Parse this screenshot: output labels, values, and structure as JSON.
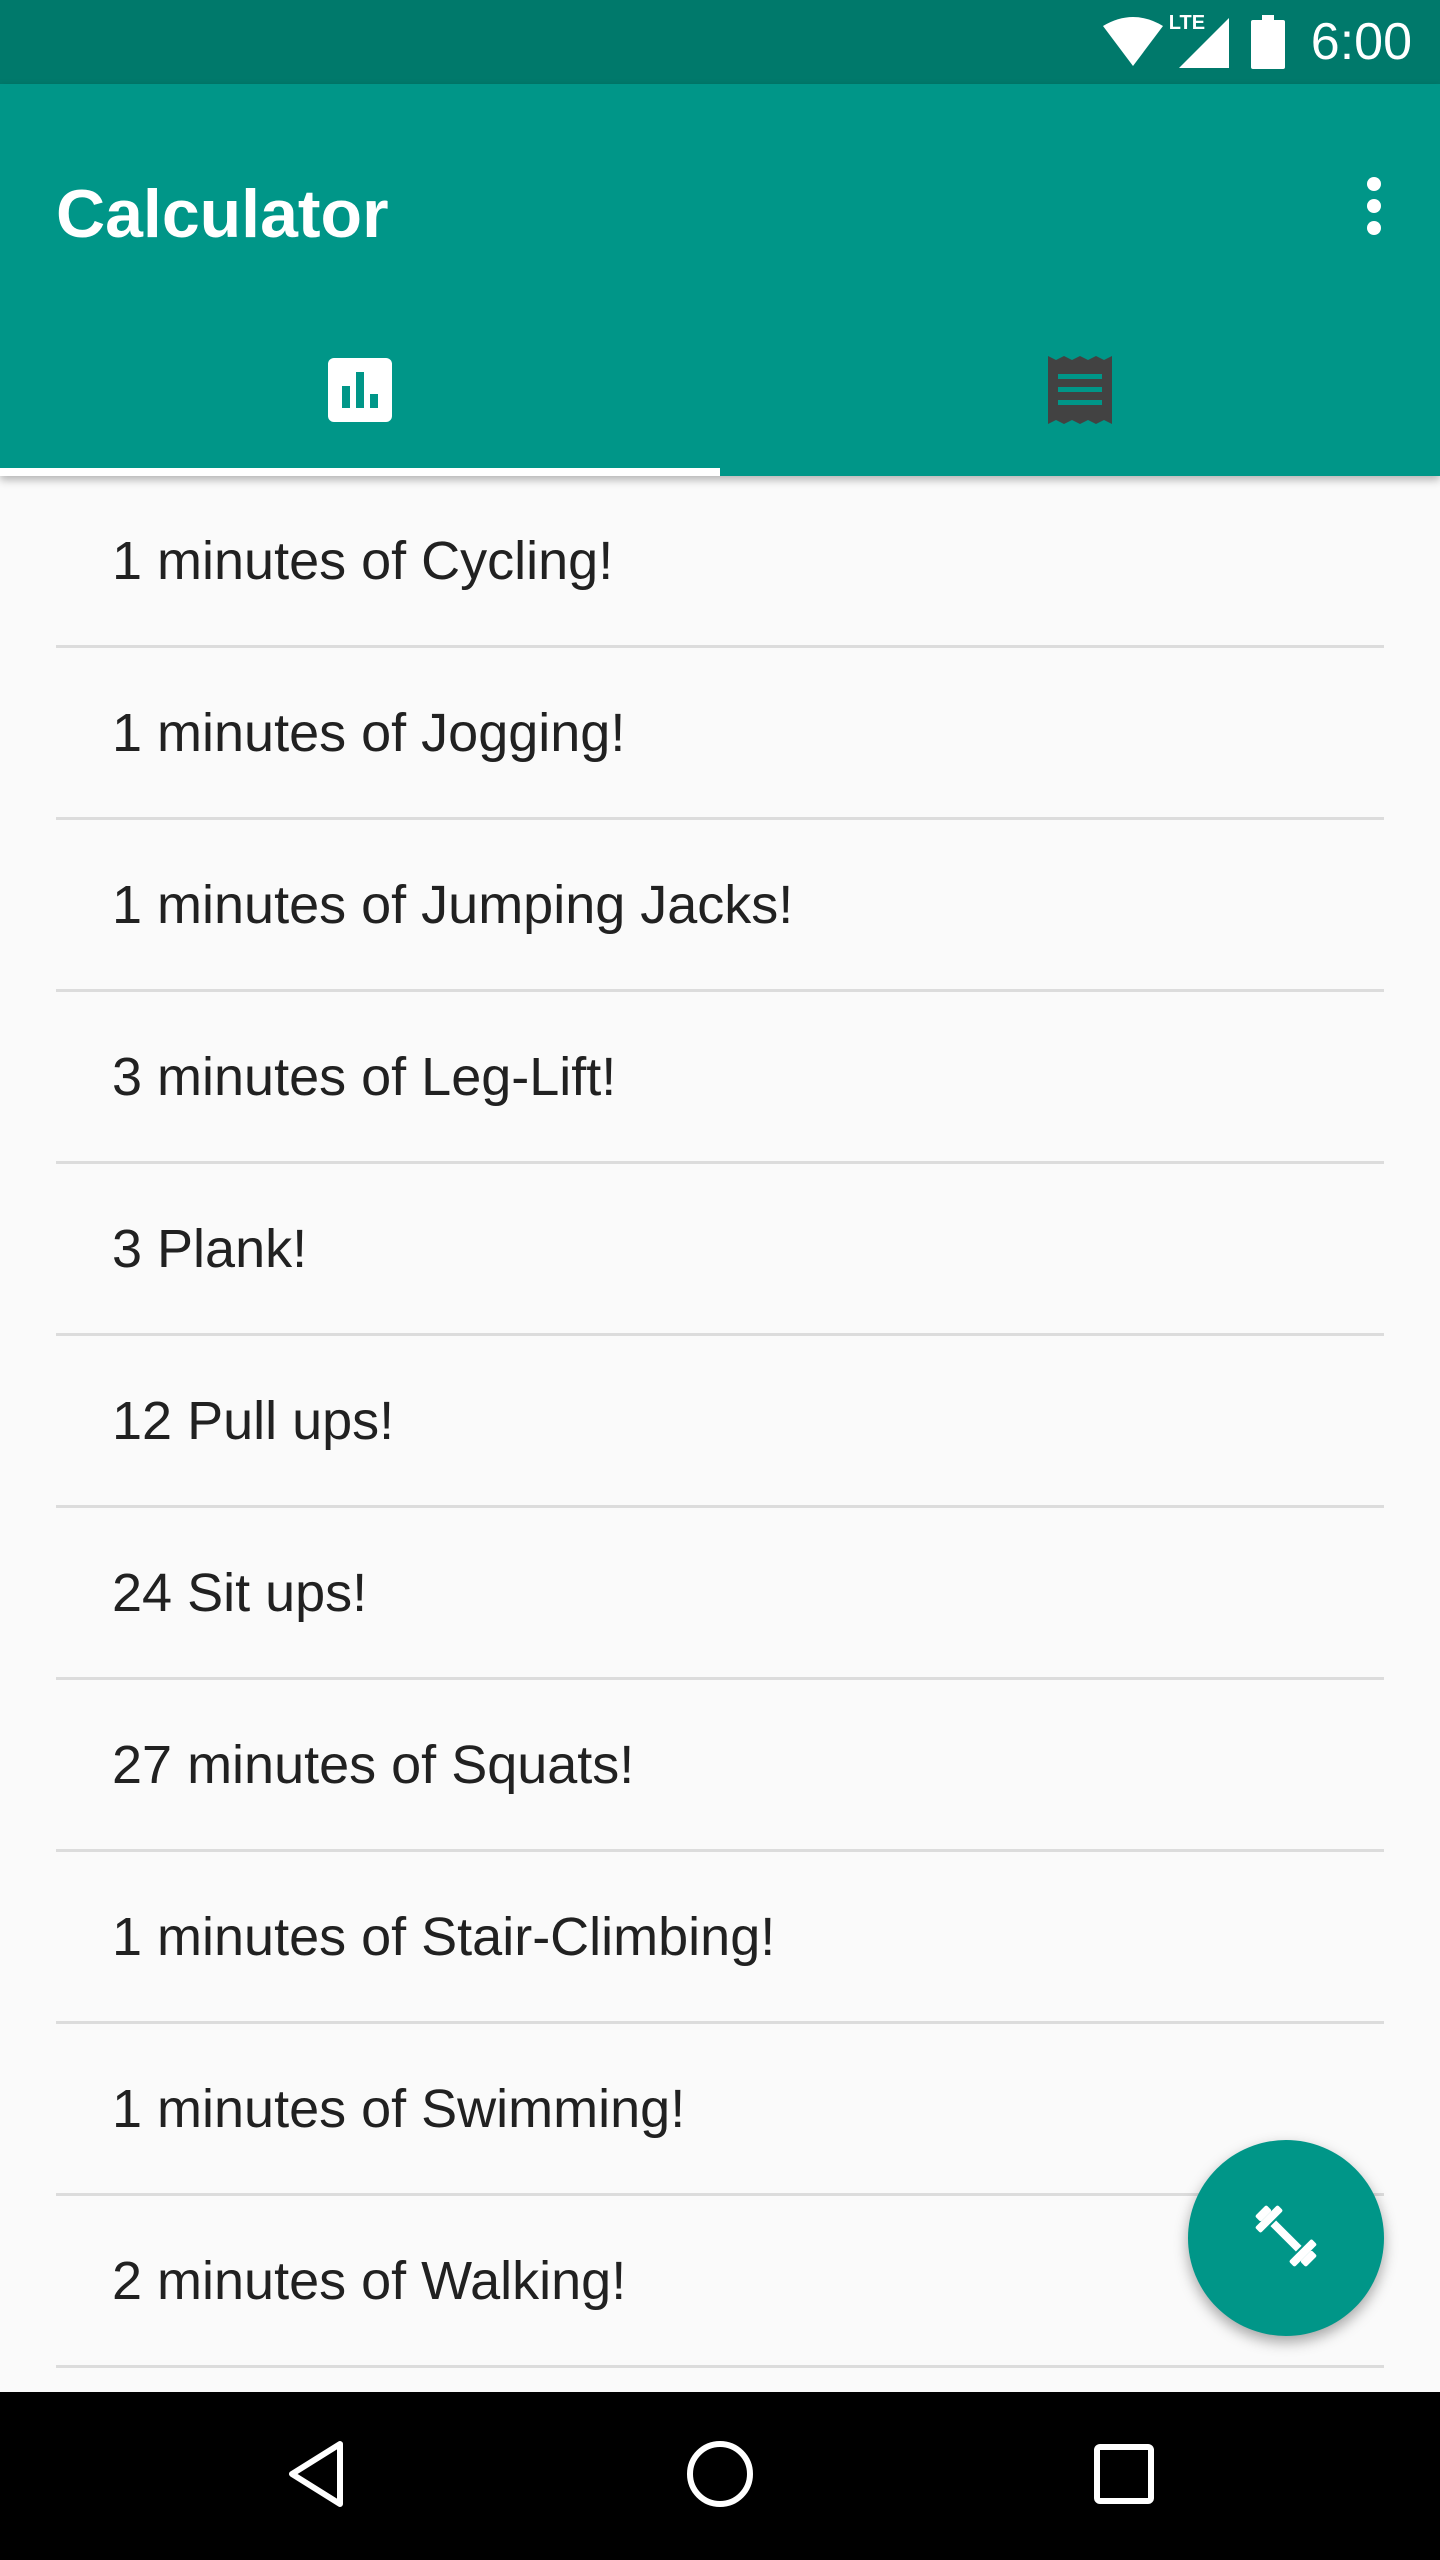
{
  "status_bar": {
    "time": "6:00",
    "network_label": "LTE",
    "icons": [
      "wifi-icon",
      "cell-signal-icon",
      "battery-icon"
    ]
  },
  "app_bar": {
    "title": "Calculator",
    "menu_icon": "more-vert-icon"
  },
  "tabs": [
    {
      "icon": "bar-chart-icon",
      "selected": true
    },
    {
      "icon": "list-document-icon",
      "selected": false
    }
  ],
  "list": {
    "items": [
      "1 minutes of Cycling!",
      "1 minutes of Jogging!",
      "1 minutes of Jumping Jacks!",
      "3 minutes of Leg-Lift!",
      "3 Plank!",
      "12 Pull ups!",
      "24 Sit ups!",
      "27 minutes of Squats!",
      "1 minutes of Stair-Climbing!",
      "1 minutes of Swimming!",
      "2 minutes of Walking!"
    ]
  },
  "fab": {
    "icon": "fitness-dumbbell-icon"
  },
  "nav_bar": {
    "icons": [
      "back-icon",
      "home-icon",
      "recents-icon"
    ]
  },
  "colors": {
    "primary": "#009688",
    "primary_dark": "#00796b",
    "background": "#fafafa",
    "divider": "#dcdcdc",
    "text_primary": "#212121",
    "tab_inactive_icon": "#424242"
  }
}
